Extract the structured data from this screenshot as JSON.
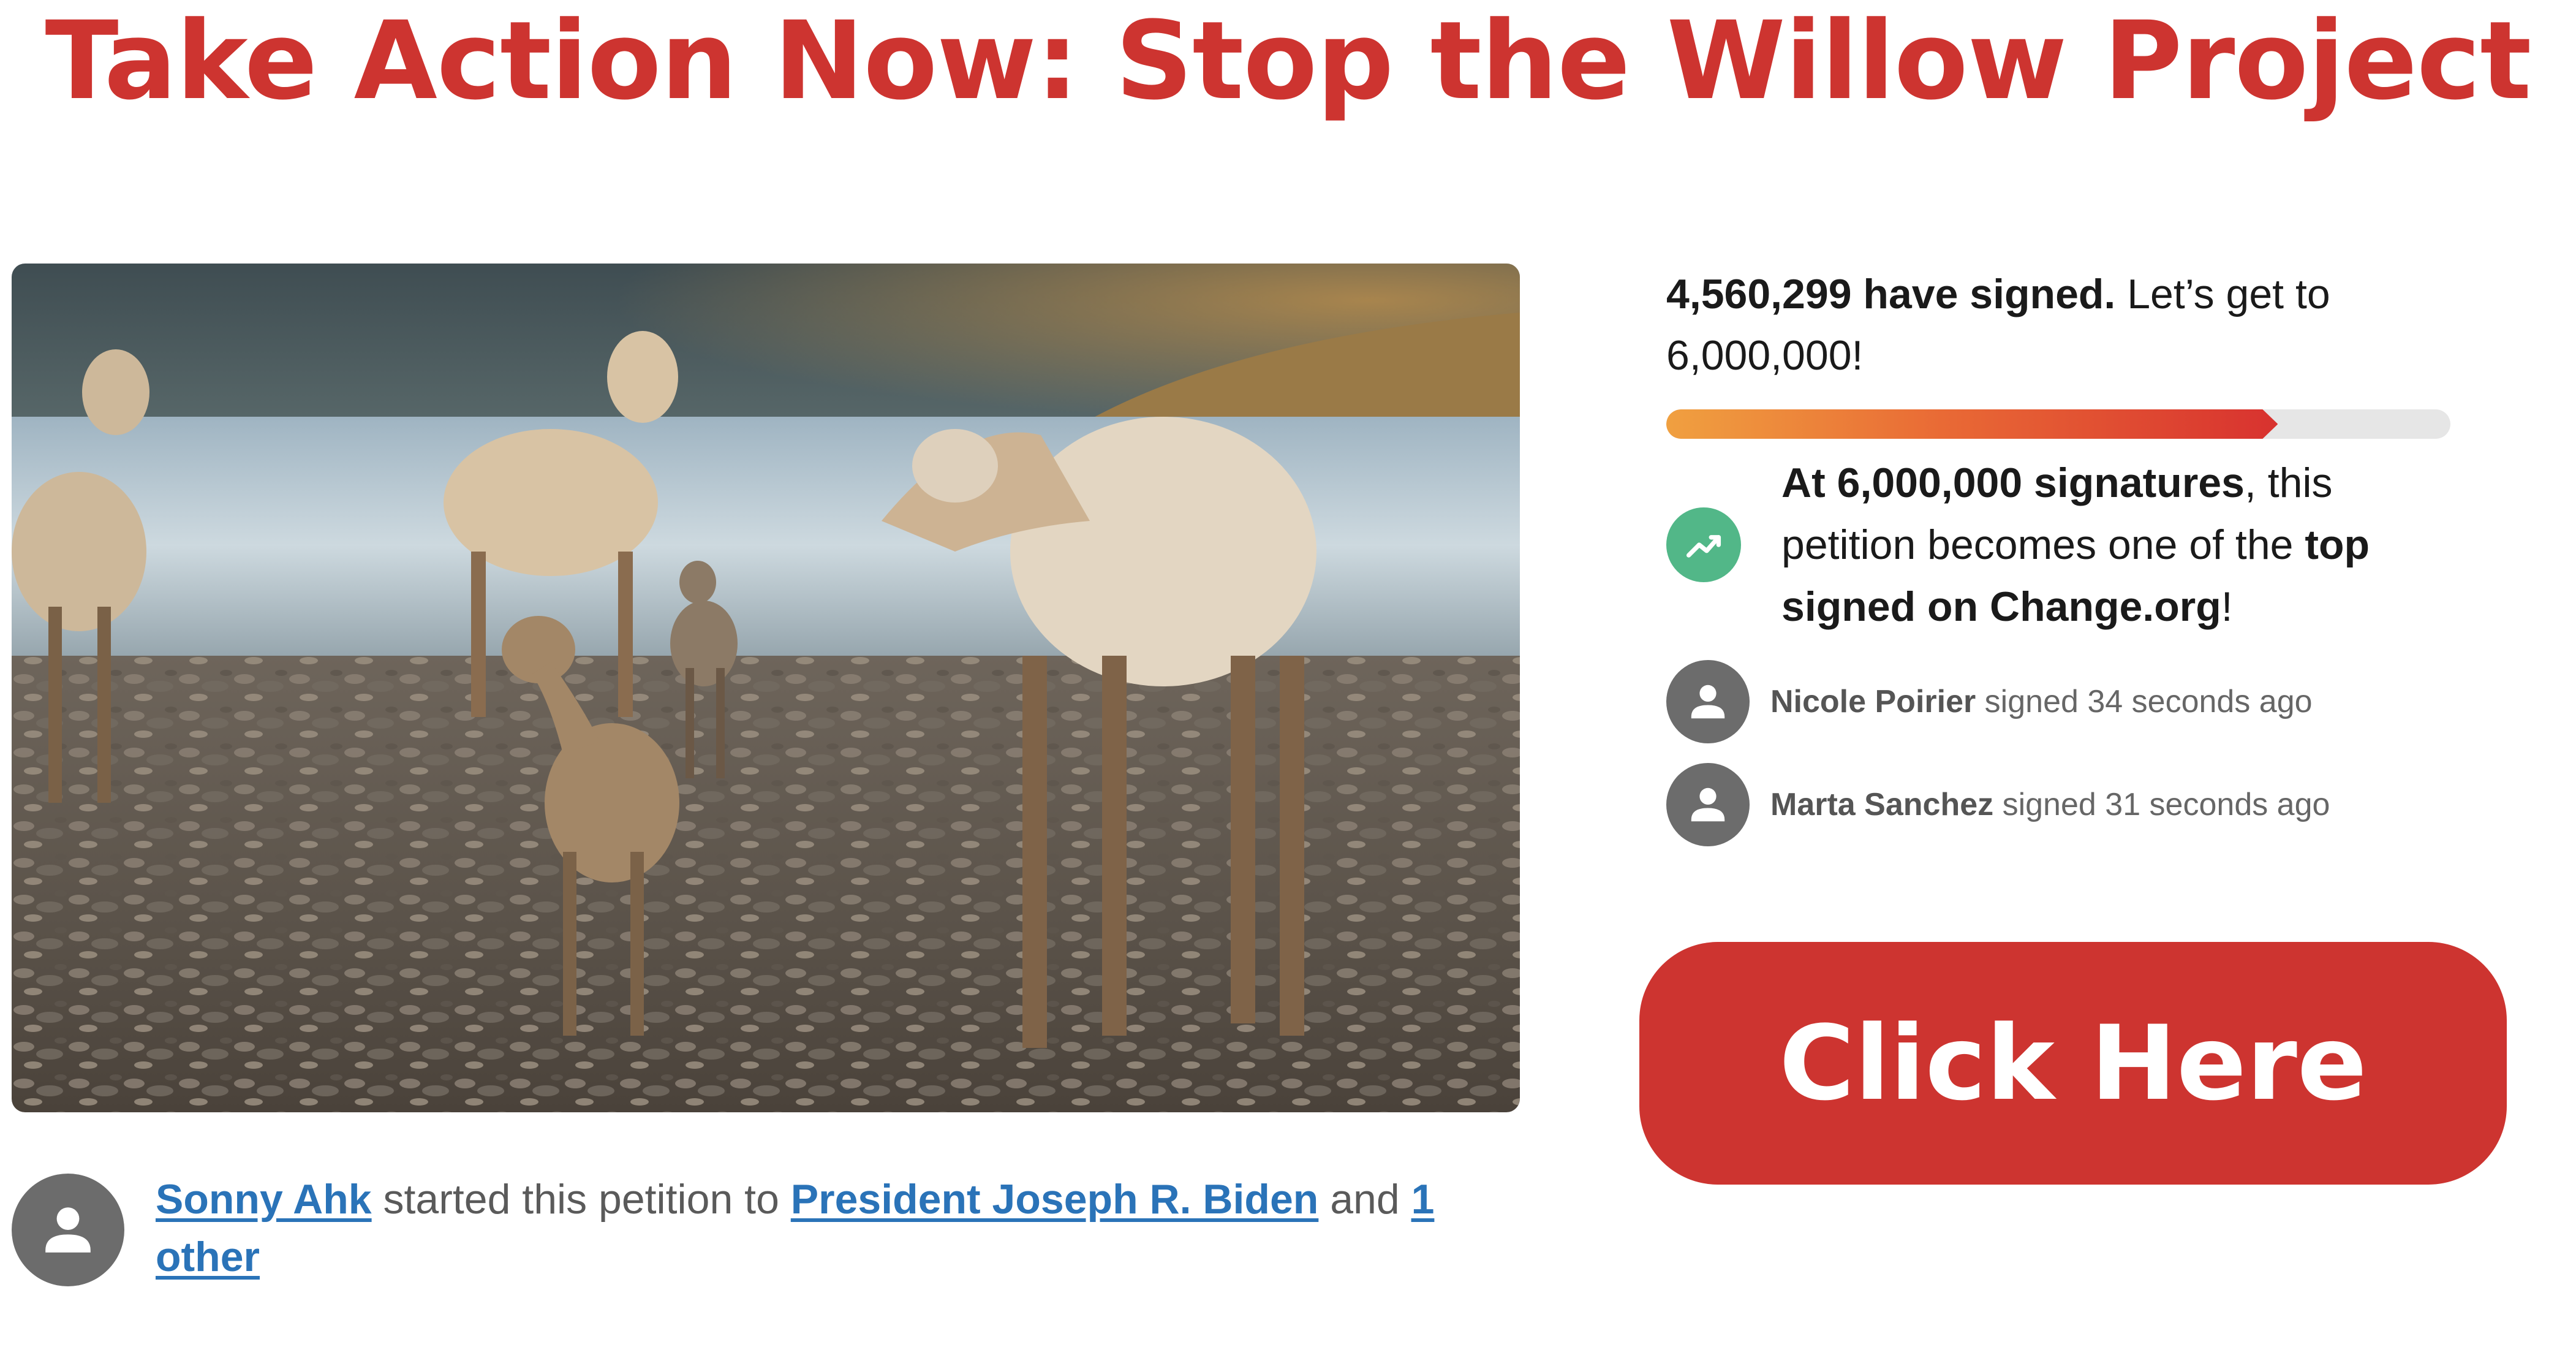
{
  "page": {
    "title": "Take Action Now: Stop the Willow Project"
  },
  "petition": {
    "starter_name": "Sonny Ahk",
    "started_text": " started this petition to ",
    "target_name": "President Joseph R. Biden",
    "and_text": " and ",
    "other_link": "1 other"
  },
  "progress": {
    "signed_count_text": "4,560,299 have signed.",
    "goal_text": " Let’s get to 6,000,000!",
    "fill_percent": 78,
    "colors": {
      "start": "#f0a040",
      "end": "#d8322f",
      "track": "#e6e6e6"
    }
  },
  "milestone": {
    "icon": "trending-up-icon",
    "bold_lead": "At 6,000,000 signatures",
    "middle_text": ", this petition becomes one of the ",
    "bold_tail": "top signed on Change.org",
    "end_text": "!"
  },
  "recent_signers": [
    {
      "name": "Nicole Poirier",
      "action": " signed 34 seconds ago"
    },
    {
      "name": "Marta Sanchez",
      "action": " signed 31 seconds ago"
    }
  ],
  "cta": {
    "label": "Click Here"
  },
  "colors": {
    "brand_red": "#cd3430",
    "link_blue": "#2a73b8",
    "avatar_gray": "#6c6c6c",
    "milestone_green": "#52b788"
  }
}
